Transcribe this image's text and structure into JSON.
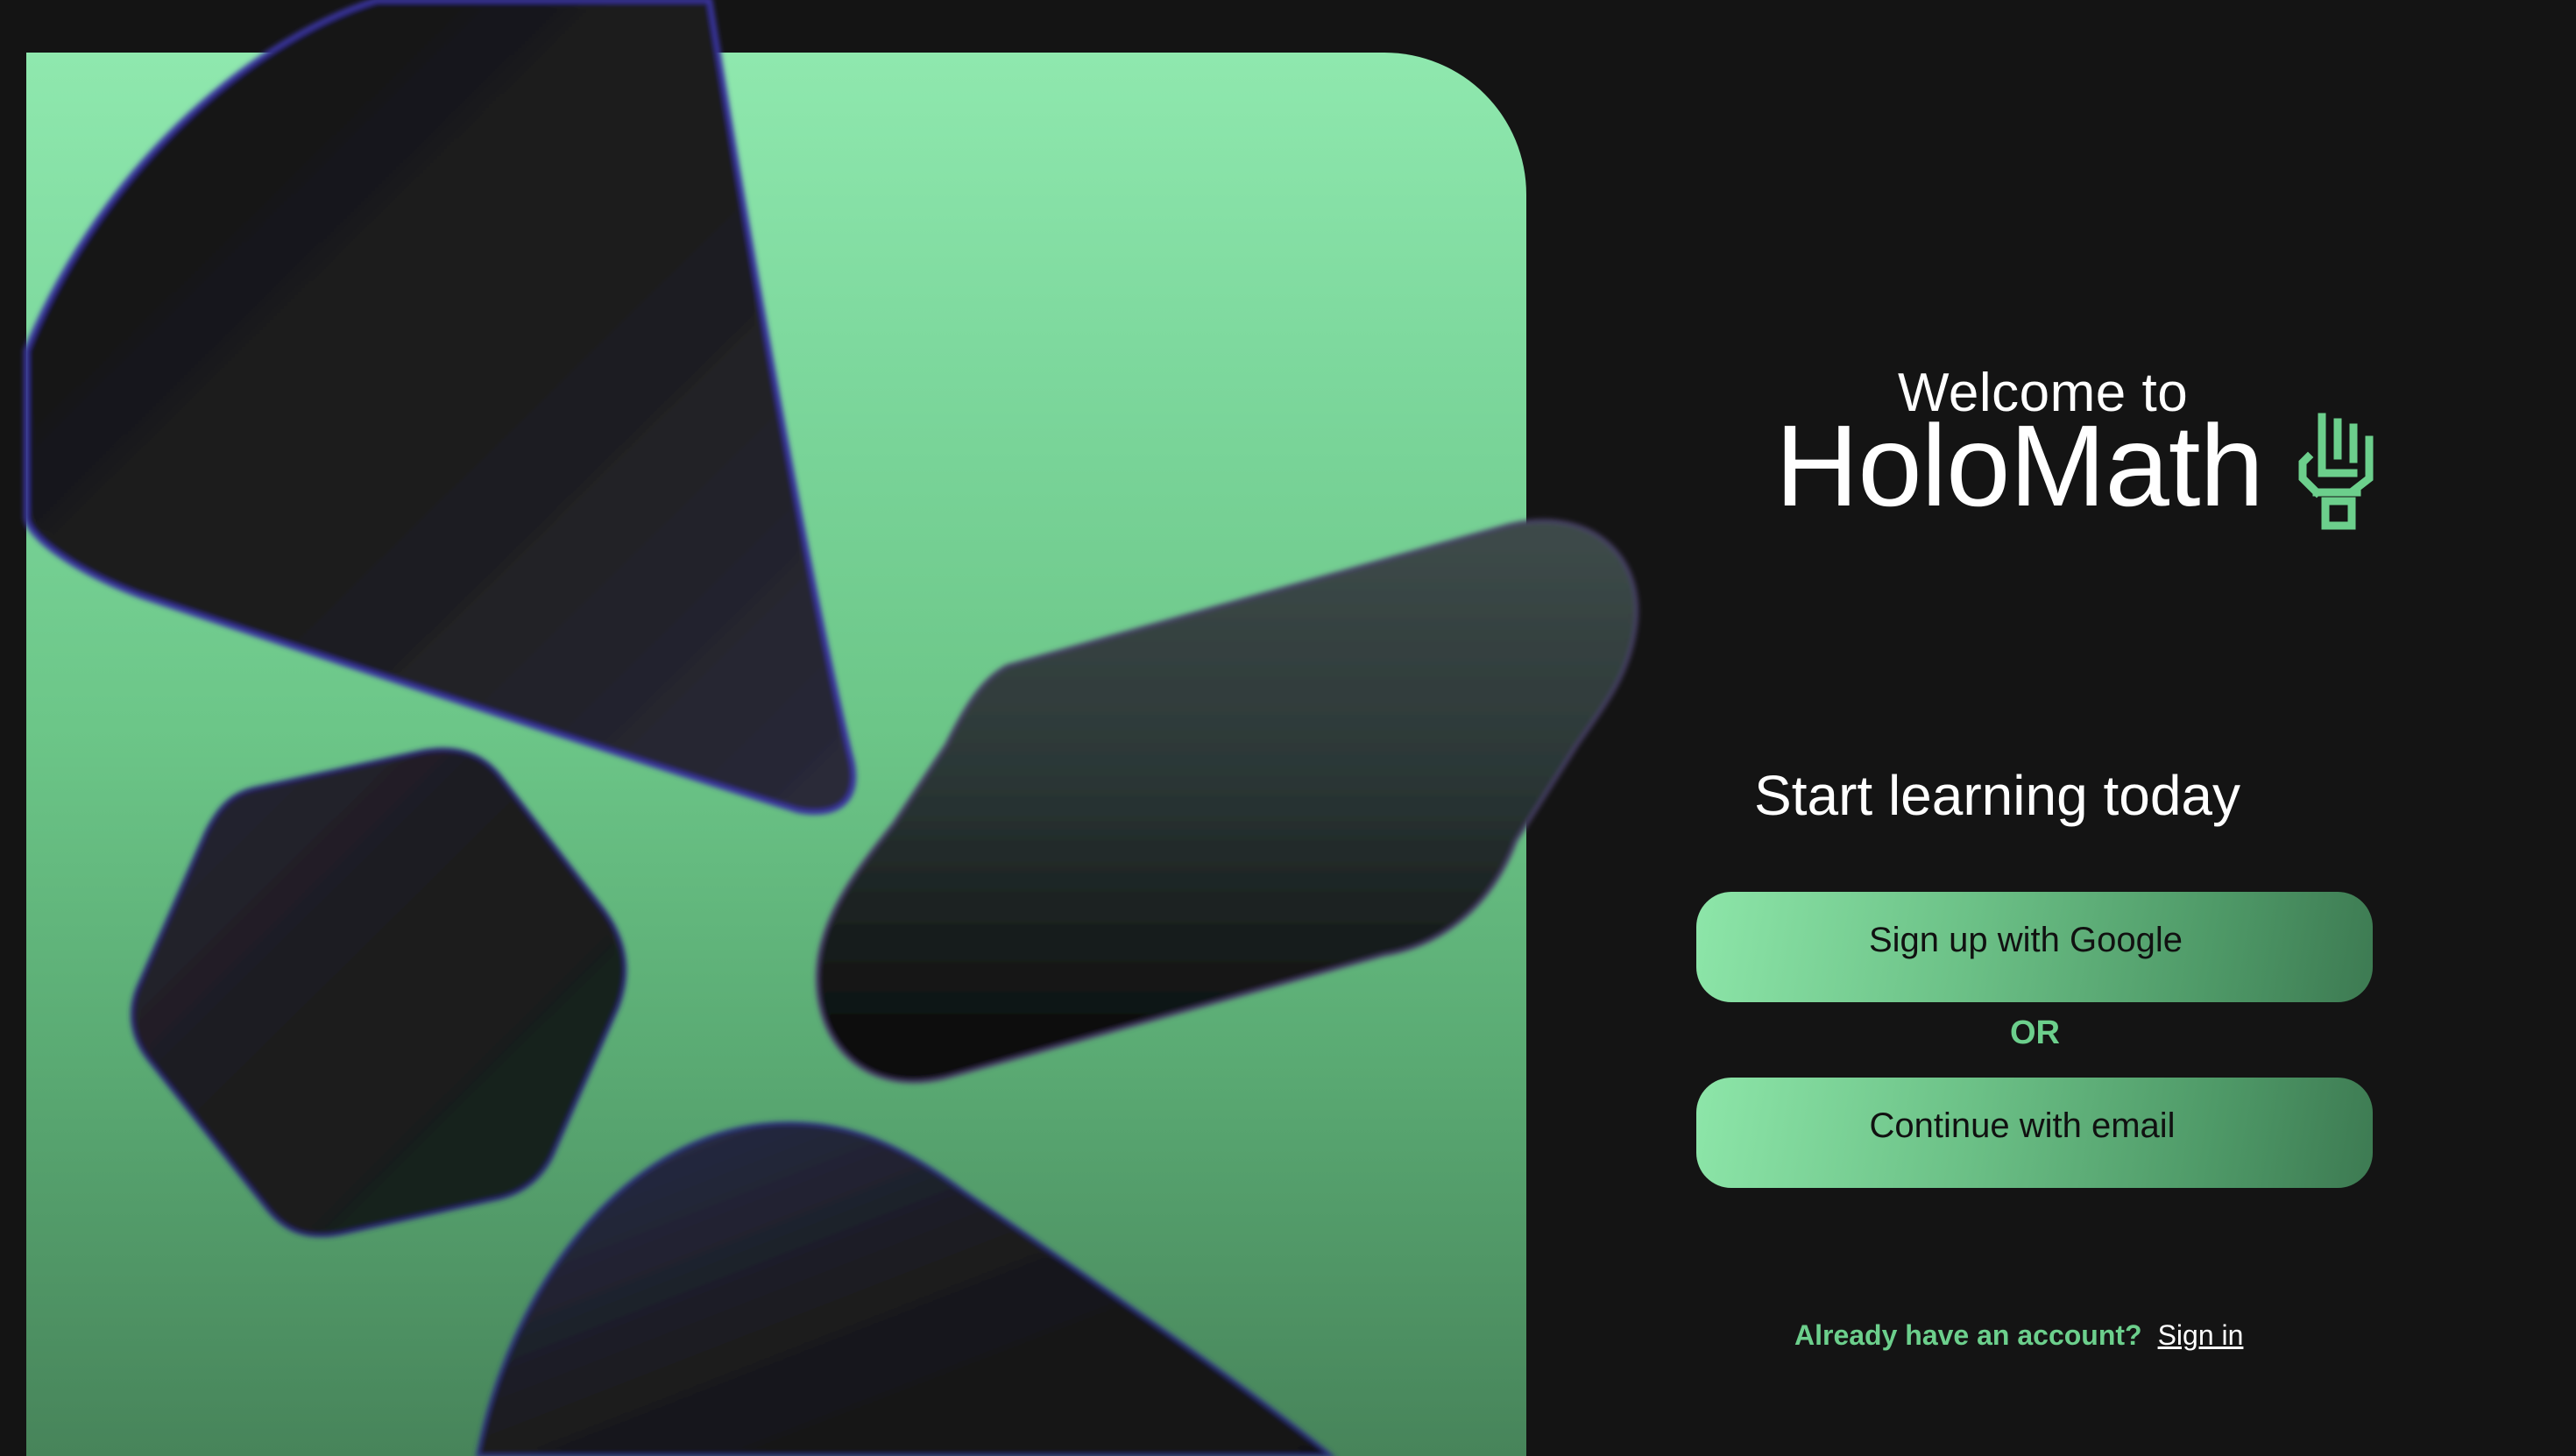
{
  "welcome": {
    "prefix": "Welcome to",
    "brand": "HoloMath",
    "icon": "robot-hand-icon"
  },
  "auth": {
    "tagline": "Start learning today",
    "google_button": "Sign up with Google",
    "divider": "OR",
    "email_button": "Continue with email",
    "account_prompt": "Already have an account?",
    "signin_link": "Sign in"
  },
  "colors": {
    "background": "#141414",
    "accent_green": "#6ccf8c",
    "panel_top": "#8fe8ae",
    "panel_bottom": "#47845a",
    "shape_dark": "#1a1a1a",
    "shape_glow": "#3b3ba8"
  },
  "hero": {
    "shapes": [
      "cone-shape",
      "cube-shape",
      "capsule-shape",
      "lower-cone-shape"
    ]
  }
}
